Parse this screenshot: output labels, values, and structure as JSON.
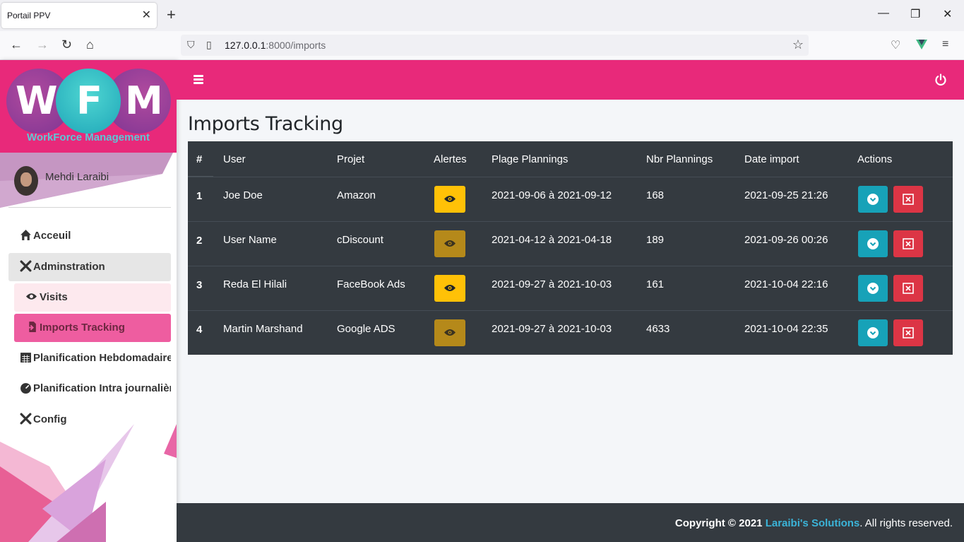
{
  "browser": {
    "tab_title": "Portail PPV",
    "tab_close_icon": "close-icon",
    "new_tab_icon": "plus-icon",
    "url_host": "127.0.0.1",
    "url_rest": ":8000/imports"
  },
  "brand": {
    "letters": [
      "W",
      "F",
      "M"
    ],
    "subtitle": "WorkForce Management",
    "colors": {
      "pink": "#e8297a",
      "purple": "#8a3d9c",
      "teal": "#2dbcc6",
      "subtitle": "#5bc8d6"
    }
  },
  "user": {
    "name": "Mehdi Laraibi"
  },
  "menu": [
    {
      "label": "Acceuil",
      "icon": "home-icon"
    },
    {
      "label": "Adminstration",
      "icon": "tools-icon"
    },
    {
      "label": "Visits",
      "icon": "eye-icon"
    },
    {
      "label": "Imports Tracking",
      "icon": "file-import-icon"
    },
    {
      "label": "Planification Hebdomadaire",
      "icon": "calendar-icon"
    },
    {
      "label": "Planification Intra journalière",
      "icon": "gauge-icon"
    },
    {
      "label": "Config",
      "icon": "tools-icon"
    }
  ],
  "header": {
    "menu_icon": "hamburger-icon",
    "power_icon": "power-icon",
    "color": "#e8297a"
  },
  "page": {
    "title": "Imports Tracking"
  },
  "table": {
    "columns": [
      "#",
      "User",
      "Projet",
      "Alertes",
      "Plage Plannings",
      "Nbr Plannings",
      "Date import",
      "Actions"
    ],
    "rows": [
      {
        "num": "1",
        "user": "Joe Doe",
        "projet": "Amazon",
        "alert_active": true,
        "plage": "2021-09-06 à 2021-09-12",
        "nbr": "168",
        "date": "2021-09-25 21:26"
      },
      {
        "num": "2",
        "user": "User Name",
        "projet": "cDiscount",
        "alert_active": false,
        "plage": "2021-04-12 à 2021-04-18",
        "nbr": "189",
        "date": "2021-09-26 00:26"
      },
      {
        "num": "3",
        "user": "Reda El Hilali",
        "projet": "FaceBook Ads",
        "alert_active": true,
        "plage": "2021-09-27 à 2021-10-03",
        "nbr": "161",
        "date": "2021-10-04 22:16"
      },
      {
        "num": "4",
        "user": "Martin Marshand",
        "projet": "Google ADS",
        "alert_active": false,
        "plage": "2021-09-27 à 2021-10-03",
        "nbr": "4633",
        "date": "2021-10-04 22:35"
      }
    ],
    "colors": {
      "bg": "#343a40",
      "alert_on": "#ffc107",
      "alert_off": "#b5891a",
      "info": "#17a2b8",
      "danger": "#dc3545"
    }
  },
  "footer": {
    "prefix": "Copyright © 2021",
    "link": "Laraibi's Solutions",
    "suffix": ". All rights reserved."
  }
}
